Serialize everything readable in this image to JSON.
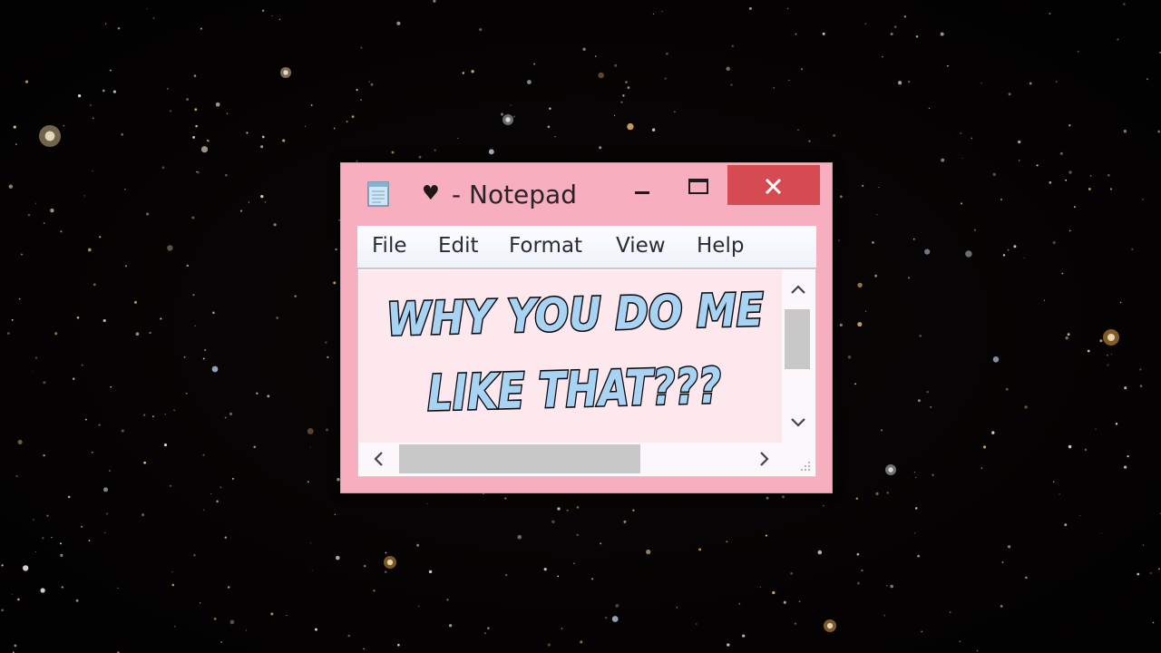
{
  "window": {
    "title_symbol": "♥",
    "title_text": "- Notepad",
    "menu": [
      "File",
      "Edit",
      "Format",
      "View",
      "Help"
    ],
    "content_lines": [
      "WHY YOU DO ME",
      "LIKE THAT???"
    ]
  },
  "colors": {
    "window_frame": "#f7aebe",
    "close_button": "#d64b52",
    "text_fill": "#a9d3f2",
    "text_outline": "#0d0d10",
    "editor_background": "#fde8ee",
    "scroll_thumb": "#c8c8c8"
  },
  "icons": {
    "app": "notepad-icon",
    "minimize": "minimize-icon",
    "maximize": "maximize-icon",
    "close": "close-icon",
    "scroll_up": "chevron-up-icon",
    "scroll_down": "chevron-down-icon",
    "scroll_left": "chevron-left-icon",
    "scroll_right": "chevron-right-icon"
  }
}
